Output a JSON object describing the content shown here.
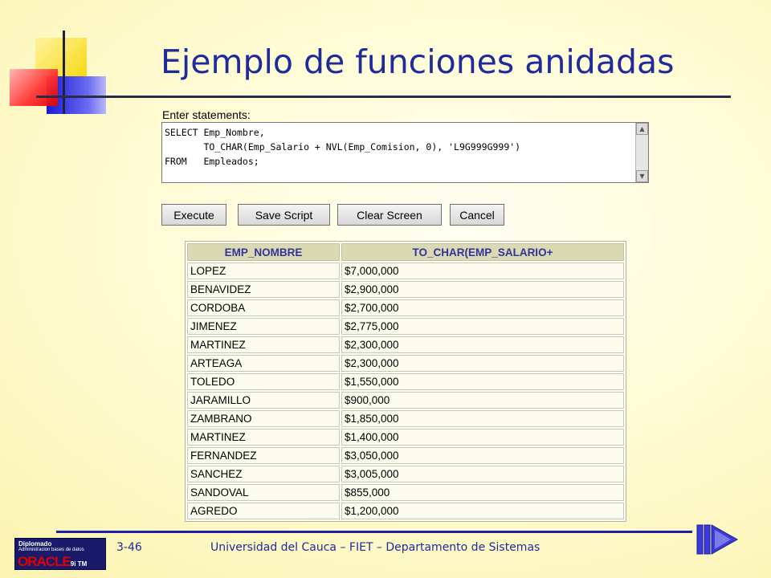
{
  "slide": {
    "title": "Ejemplo de funciones anidadas",
    "footer_number": "3-46",
    "footer_text": "Universidad del Cauca – FIET – Departamento de Sistemas"
  },
  "logo": {
    "line1": "Diplomado",
    "line2": "Administracion bases de datos",
    "brand": "ORACLE",
    "version": "9i TM"
  },
  "editor": {
    "label": "Enter statements:",
    "sql": "SELECT Emp_Nombre,\n       TO_CHAR(Emp_Salario + NVL(Emp_Comision, 0), 'L9G999G999')\nFROM   Empleados;"
  },
  "buttons": {
    "execute": "Execute",
    "save_script": "Save Script",
    "clear_screen": "Clear Screen",
    "cancel": "Cancel"
  },
  "results": {
    "columns": [
      "EMP_NOMBRE",
      "TO_CHAR(EMP_SALARIO+"
    ],
    "rows": [
      [
        "LOPEZ",
        "$7,000,000"
      ],
      [
        "BENAVIDEZ",
        "$2,900,000"
      ],
      [
        "CORDOBA",
        "$2,700,000"
      ],
      [
        "JIMENEZ",
        "$2,775,000"
      ],
      [
        "MARTINEZ",
        "$2,300,000"
      ],
      [
        "ARTEAGA",
        "$2,300,000"
      ],
      [
        "TOLEDO",
        "$1,550,000"
      ],
      [
        "JARAMILLO",
        "$900,000"
      ],
      [
        "ZAMBRANO",
        "$1,850,000"
      ],
      [
        "MARTINEZ",
        "$1,400,000"
      ],
      [
        "FERNANDEZ",
        "$3,050,000"
      ],
      [
        "SANCHEZ",
        "$3,005,000"
      ],
      [
        "SANDOVAL",
        "$855,000"
      ],
      [
        "AGREDO",
        "$1,200,000"
      ]
    ]
  },
  "colors": {
    "title": "#1f2b9c",
    "header_bg": "#d9d9b3",
    "header_text": "#33339a"
  }
}
